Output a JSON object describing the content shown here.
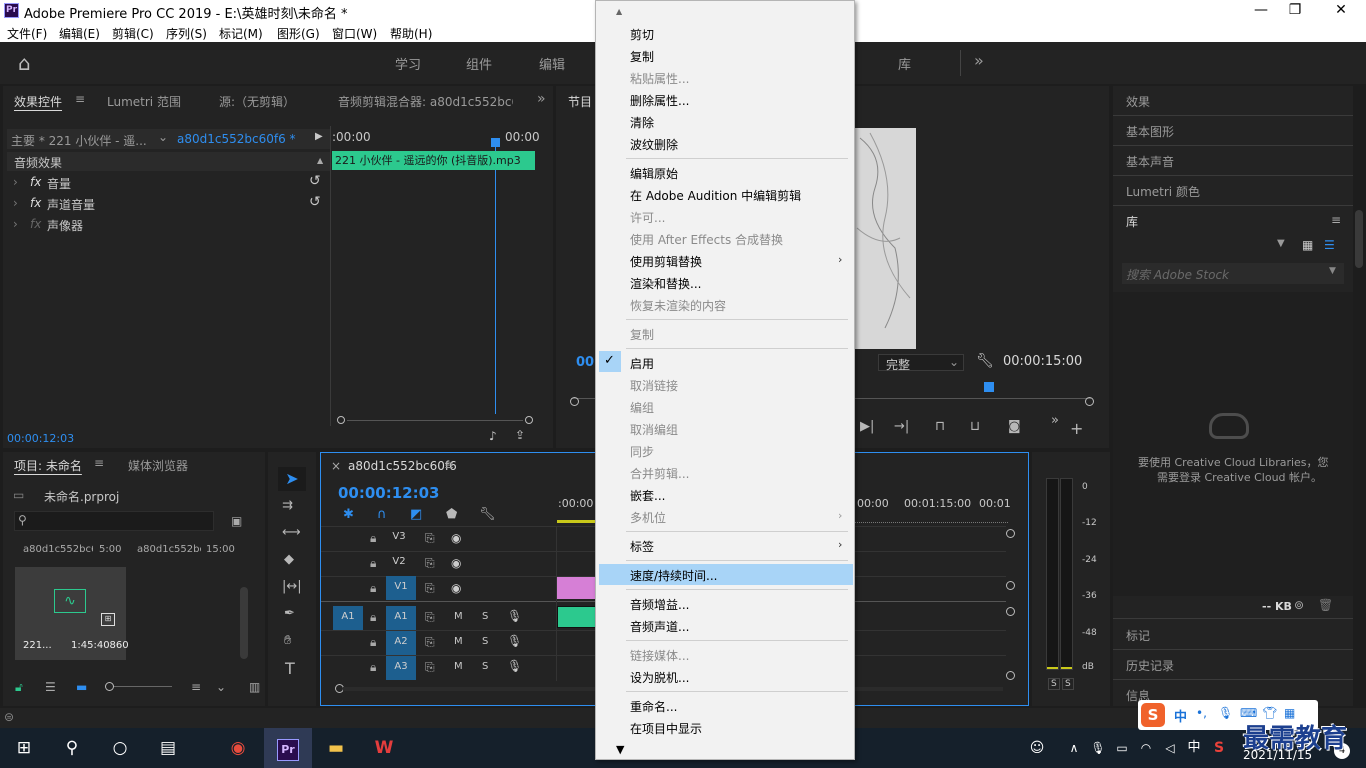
{
  "window": {
    "title": "Adobe Premiere Pro CC 2019 - E:\\英雄时刻\\未命名 *",
    "app_icon": "Pr",
    "minimize": "—",
    "maximize": "❐",
    "close": "✕"
  },
  "menubar": [
    "文件(F)",
    "编辑(E)",
    "剪辑(C)",
    "序列(S)",
    "标记(M)",
    "图形(G)",
    "窗口(W)",
    "帮助(H)"
  ],
  "workspaces": {
    "home": "⌂",
    "items": [
      "学习",
      "组件",
      "编辑",
      "库"
    ],
    "more": "»"
  },
  "effect_controls": {
    "tabs": [
      "效果控件",
      "Lumetri 范围",
      "源:（无剪辑）",
      "音频剪辑混合器: a80d1c552bc6("
    ],
    "more": "»",
    "master": "主要 * 221 小伙伴 - 遥...",
    "clip": "a80d1c552bc60f6 * 22...",
    "section": "音频效果",
    "effects": [
      "音量",
      "声道音量",
      "声像器"
    ],
    "fx": "fx",
    "ruler_left": ":00:00",
    "ruler_right": "00:00",
    "clip_bar": "221 小伙伴 - 遥远的你 (抖音版).mp3",
    "timecode": "00:00:12:03"
  },
  "program": {
    "tab": "节目",
    "left_timecode": "00:",
    "quality": "完整",
    "duration": "00:00:15:00"
  },
  "right_panel": {
    "items": [
      "效果",
      "基本图形",
      "基本声音",
      "Lumetri 颜色"
    ],
    "library_title": "库",
    "search_placeholder": "搜索 Adobe Stock",
    "cc_message_1": "要使用 Creative Cloud Libraries，您",
    "cc_message_2": "需要登录 Creative Cloud 帐户。",
    "kb": "-- KB",
    "bottom_items": [
      "标记",
      "历史记录",
      "信息"
    ]
  },
  "project": {
    "tabs": [
      "项目: 未命名",
      "媒体浏览器"
    ],
    "file": "未命名.prproj",
    "col1": "a80d1c552bc6...",
    "col1_dur": "5:00",
    "col2": "a80d1c552bc...",
    "col2_dur": "15:00",
    "thumb_name": "221...",
    "thumb_dur": "1:45:40860"
  },
  "timeline": {
    "close": "×",
    "seq": "a80d1c552bc60f6",
    "timecode": "00:00:12:03",
    "ruler": [
      ":00:00",
      "00:00",
      "00:01:15:00",
      "00:01"
    ],
    "video_tracks": [
      "V3",
      "V2",
      "V1"
    ],
    "audio_tracks": [
      "A1",
      "A2",
      "A3"
    ],
    "source_patch": "A1",
    "m": "M",
    "s": "S"
  },
  "meter": {
    "scale": [
      "0",
      "-12",
      "-24",
      "-36",
      "-48",
      "dB"
    ],
    "solo": [
      "S",
      "S"
    ]
  },
  "context_menu": {
    "items": [
      {
        "label": "剪切",
        "enabled": true
      },
      {
        "label": "复制",
        "enabled": true
      },
      {
        "label": "粘贴属性...",
        "enabled": false
      },
      {
        "label": "删除属性...",
        "enabled": true
      },
      {
        "label": "清除",
        "enabled": true
      },
      {
        "label": "波纹删除",
        "enabled": true
      },
      {
        "label": "编辑原始",
        "enabled": true
      },
      {
        "label": "在 Adobe Audition 中编辑剪辑",
        "enabled": true
      },
      {
        "label": "许可...",
        "enabled": false
      },
      {
        "label": "使用 After Effects 合成替换",
        "enabled": false
      },
      {
        "label": "使用剪辑替换",
        "enabled": true
      },
      {
        "label": "渲染和替换...",
        "enabled": true
      },
      {
        "label": "恢复未渲染的内容",
        "enabled": false
      },
      {
        "label": "复制",
        "enabled": false
      },
      {
        "label": "启用",
        "enabled": true
      },
      {
        "label": "取消链接",
        "enabled": false
      },
      {
        "label": "编组",
        "enabled": false
      },
      {
        "label": "取消编组",
        "enabled": false
      },
      {
        "label": "同步",
        "enabled": false
      },
      {
        "label": "合并剪辑...",
        "enabled": false
      },
      {
        "label": "嵌套...",
        "enabled": true
      },
      {
        "label": "多机位",
        "enabled": false
      },
      {
        "label": "标签",
        "enabled": true
      },
      {
        "label": "速度/持续时间...",
        "enabled": true
      },
      {
        "label": "音频增益...",
        "enabled": true
      },
      {
        "label": "音频声道...",
        "enabled": true
      },
      {
        "label": "链接媒体...",
        "enabled": false
      },
      {
        "label": "设为脱机...",
        "enabled": true
      },
      {
        "label": "重命名...",
        "enabled": true
      },
      {
        "label": "在项目中显示",
        "enabled": true
      }
    ],
    "checked_item": "启用",
    "highlighted_item": "速度/持续时间...",
    "check": "✓",
    "submenu_arrow": "›",
    "scroll_up": "▲",
    "scroll_down": "▼"
  },
  "taskbar": {
    "tray_time": "2021/11/15",
    "ime": "中",
    "watermark": "最需教育",
    "notifications": "4"
  },
  "colors": {
    "accent_blue": "#2e8ef0",
    "audio_clip_green": "#2cc98e",
    "video_clip_pink": "#d67fd6",
    "highlight": "#a8d4f7"
  }
}
